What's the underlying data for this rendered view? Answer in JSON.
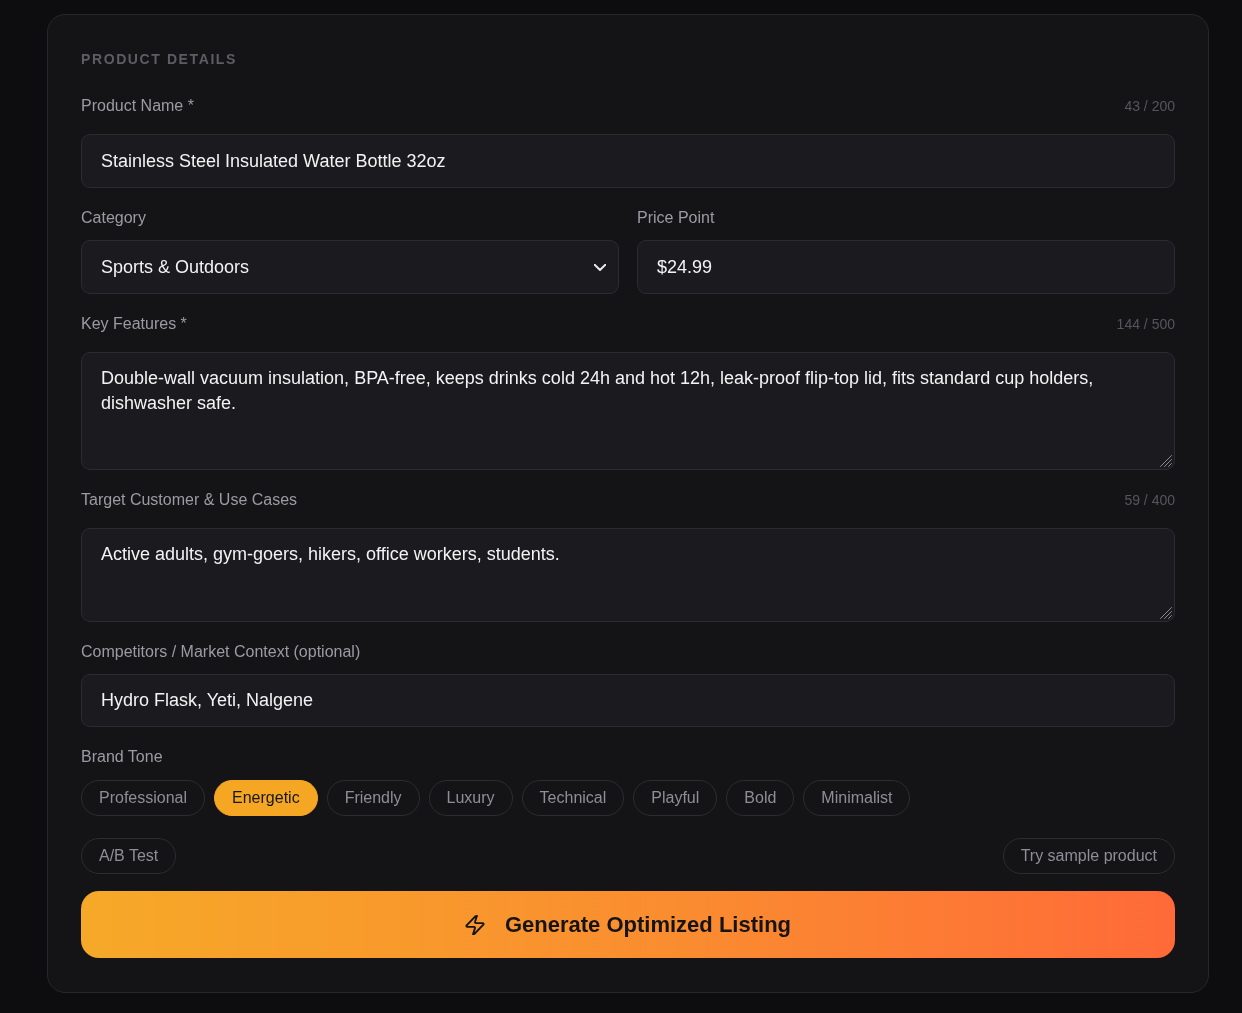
{
  "section": {
    "title": "PRODUCT DETAILS"
  },
  "product_name": {
    "label": "Product Name *",
    "counter": "43 / 200",
    "value": "Stainless Steel Insulated Water Bottle 32oz"
  },
  "category": {
    "label": "Category",
    "value": "Sports & Outdoors"
  },
  "price_point": {
    "label": "Price Point",
    "value": "$24.99"
  },
  "key_features": {
    "label": "Key Features *",
    "counter": "144 / 500",
    "value": "Double-wall vacuum insulation, BPA-free, keeps drinks cold 24h and hot 12h, leak-proof flip-top lid, fits standard cup holders, dishwasher safe."
  },
  "target_customer": {
    "label": "Target Customer & Use Cases",
    "counter": "59 / 400",
    "value": "Active adults, gym-goers, hikers, office workers, students."
  },
  "competitors": {
    "label": "Competitors / Market Context (optional)",
    "value": "Hydro Flask, Yeti, Nalgene"
  },
  "brand_tone": {
    "label": "Brand Tone",
    "options": [
      {
        "label": "Professional",
        "selected": false
      },
      {
        "label": "Energetic",
        "selected": true
      },
      {
        "label": "Friendly",
        "selected": false
      },
      {
        "label": "Luxury",
        "selected": false
      },
      {
        "label": "Technical",
        "selected": false
      },
      {
        "label": "Playful",
        "selected": false
      },
      {
        "label": "Bold",
        "selected": false
      },
      {
        "label": "Minimalist",
        "selected": false
      }
    ]
  },
  "ab_test": {
    "label": "A/B Test",
    "on": false
  },
  "sample_button": {
    "label": "Try sample product"
  },
  "generate_button": {
    "label": "Generate Optimized Listing"
  }
}
